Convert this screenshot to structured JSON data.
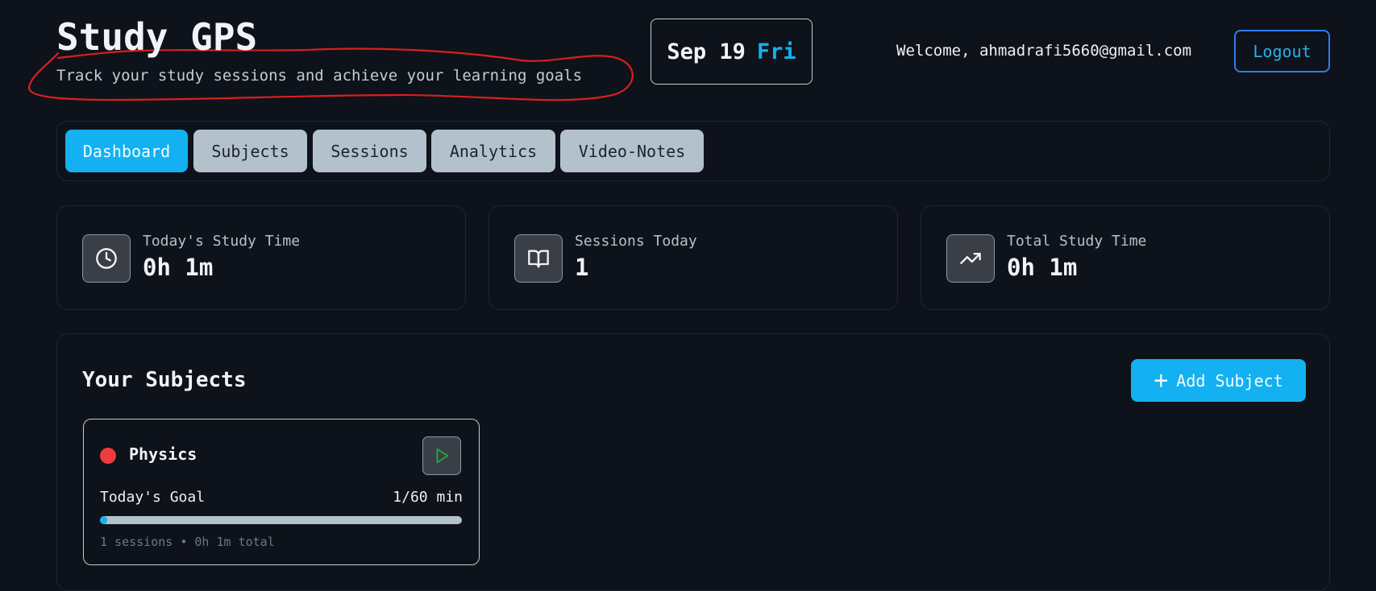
{
  "header": {
    "title": "Study GPS",
    "subtitle": "Track your study sessions and achieve your learning goals"
  },
  "date": {
    "month_day": "Sep 19",
    "weekday": "Fri"
  },
  "user": {
    "welcome": "Welcome, ahmadrafi5660@gmail.com",
    "logout_label": "Logout"
  },
  "tabs": [
    {
      "label": "Dashboard",
      "active": true
    },
    {
      "label": "Subjects",
      "active": false
    },
    {
      "label": "Sessions",
      "active": false
    },
    {
      "label": "Analytics",
      "active": false
    },
    {
      "label": "Video-Notes",
      "active": false
    }
  ],
  "stats": [
    {
      "label": "Today's Study Time",
      "value": "0h 1m",
      "icon": "clock-icon"
    },
    {
      "label": "Sessions Today",
      "value": "1",
      "icon": "book-open-icon"
    },
    {
      "label": "Total Study Time",
      "value": "0h 1m",
      "icon": "trending-up-icon"
    }
  ],
  "subjects_panel": {
    "title": "Your Subjects",
    "add_label": "Add Subject",
    "subjects": [
      {
        "name": "Physics",
        "color": "#ef3b3b",
        "goal_label": "Today's Goal",
        "goal_value": "1/60 min",
        "progress_fraction": 0.0167,
        "meta": "1 sessions • 0h 1m total"
      }
    ]
  },
  "colors": {
    "accent": "#13b1f1",
    "logout_border": "#2f7cf0",
    "annotation": "#d91f1f"
  }
}
